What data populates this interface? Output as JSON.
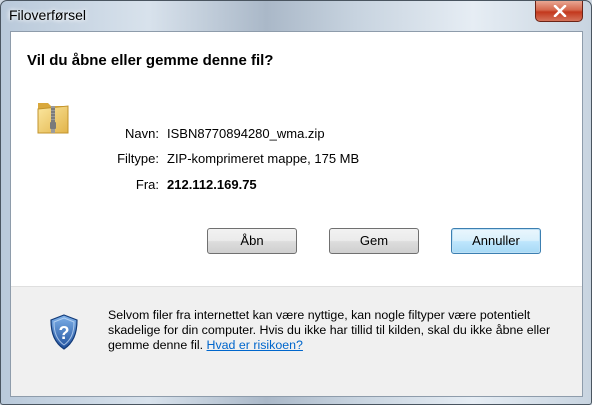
{
  "window": {
    "title": "Filoverførsel"
  },
  "dialog": {
    "heading": "Vil du åbne eller gemme denne fil?",
    "file": {
      "name_label": "Navn:",
      "name_value": "ISBN8770894280_wma.zip",
      "type_label": "Filtype:",
      "type_value": "ZIP-komprimeret mappe, 175 MB",
      "from_label": "Fra:",
      "from_value": "212.112.169.75"
    },
    "buttons": {
      "open": "Åbn",
      "save": "Gem",
      "cancel": "Annuller"
    },
    "warning": {
      "text": "Selvom filer fra internettet kan være nyttige, kan nogle filtyper være potentielt skadelige for din computer. Hvis du ikke har tillid til kilden, skal du ikke åbne eller gemme denne fil.",
      "link": "Hvad er risikoen?"
    }
  },
  "icons": {
    "close": "close-icon",
    "file": "zip-folder-icon",
    "warning": "security-shield-icon"
  },
  "colors": {
    "close_button": "#c3381d",
    "default_button_border": "#3c7fb1",
    "link": "#0066cc",
    "footer_background": "#f0f0f0"
  }
}
